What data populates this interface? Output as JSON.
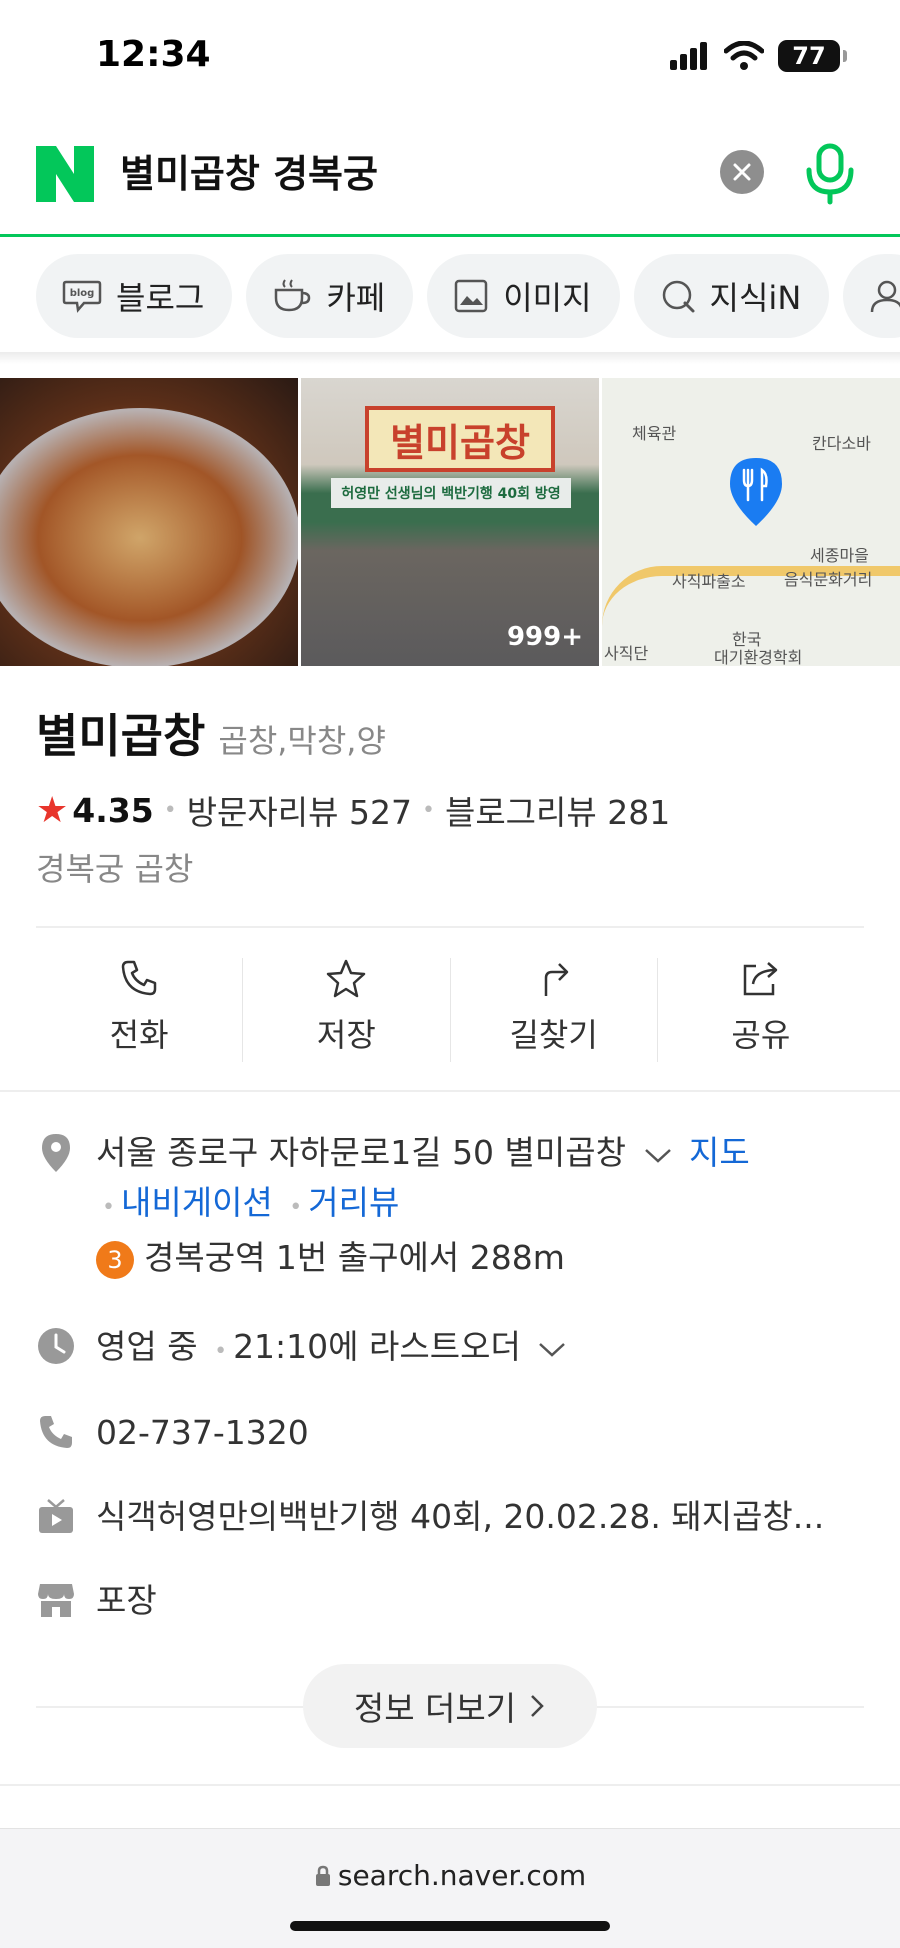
{
  "status": {
    "time": "12:34",
    "battery": "77"
  },
  "search": {
    "query": "별미곱창 경복궁"
  },
  "chips": [
    {
      "label": "블로그",
      "icon": "blog-icon"
    },
    {
      "label": "카페",
      "icon": "cafe-icon"
    },
    {
      "label": "이미지",
      "icon": "image-icon"
    },
    {
      "label": "지식iN",
      "icon": "kin-icon"
    }
  ],
  "photos": {
    "store_sign": "별미곱창",
    "store_banner": "허영만 선생님의 백반기행 40회 방영",
    "count": "999+",
    "map_labels": [
      "체육관",
      "칸다소바",
      "사직파출소",
      "세종마을",
      "음식문화거리",
      "사직단",
      "한국",
      "대기환경학회"
    ]
  },
  "place": {
    "name": "별미곱창",
    "category": "곱창,막창,양",
    "rating": "4.35",
    "visitor_reviews": "방문자리뷰 527",
    "blog_reviews": "블로그리뷰 281",
    "area": "경복궁 곱창"
  },
  "actions": [
    {
      "label": "전화"
    },
    {
      "label": "저장"
    },
    {
      "label": "길찾기"
    },
    {
      "label": "공유"
    }
  ],
  "info": {
    "address": "서울 종로구 자하문로1길 50 별미곱창",
    "map_link": "지도",
    "nav_link": "내비게이션",
    "street_link": "거리뷰",
    "subway_line": "3",
    "subway_text": "경복궁역 1번 출구에서 288m",
    "status": "영업 중",
    "last_order": "21:10에 라스트오더",
    "phone": "02-737-1320",
    "tv": "식객허영만의백반기행 40회, 20.02.28. 돼지곱창...",
    "service": "포장"
  },
  "more_label": "정보 더보기",
  "browser": {
    "url": "search.naver.com"
  },
  "colors": {
    "naver_green": "#03c75a",
    "link_blue": "#1468d6",
    "star_red": "#e8352c",
    "subway_orange": "#f07a19"
  }
}
